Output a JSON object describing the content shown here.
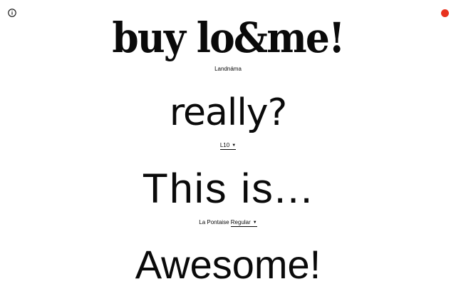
{
  "icons": {
    "info": "info-circle-icon",
    "status_dot_color": "#e8321e"
  },
  "specimens": [
    {
      "text": "buy lo&me!",
      "font_label": "Landnáma"
    },
    {
      "text": "really?",
      "font_label": "L10"
    },
    {
      "text": "This is...",
      "font_label_prefix": "La Pontaise",
      "font_label": "Regular"
    },
    {
      "text": "Awesome!"
    }
  ]
}
